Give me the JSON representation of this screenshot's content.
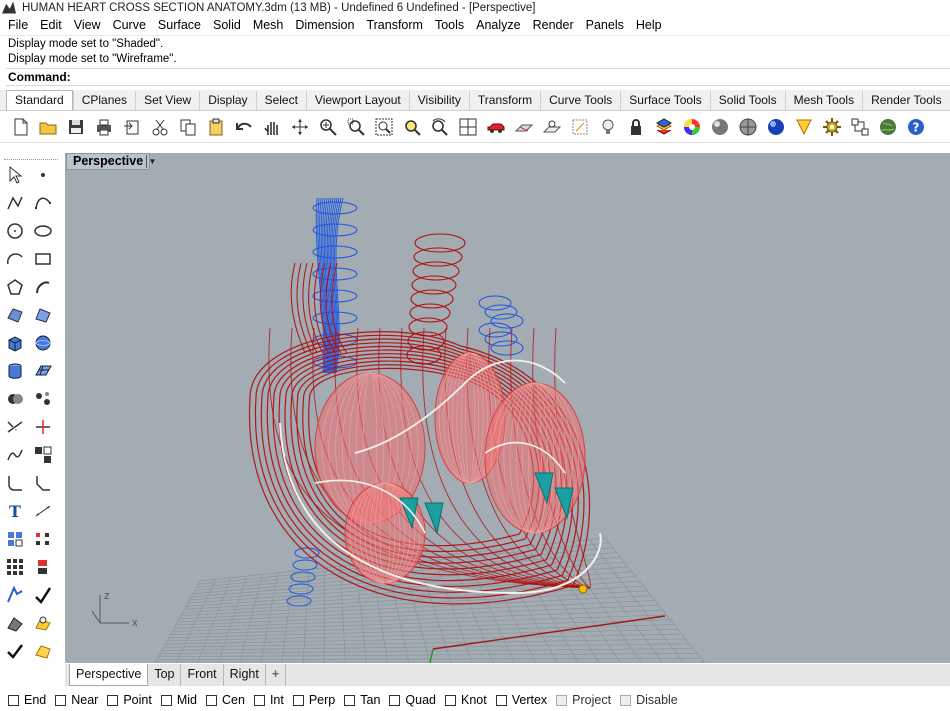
{
  "window": {
    "title": "HUMAN HEART CROSS SECTION ANATOMY.3dm (13 MB) - Undefined 6 Undefined - [Perspective]"
  },
  "menu": [
    "File",
    "Edit",
    "View",
    "Curve",
    "Surface",
    "Solid",
    "Mesh",
    "Dimension",
    "Transform",
    "Tools",
    "Analyze",
    "Render",
    "Panels",
    "Help"
  ],
  "history": [
    "Display mode set to \"Shaded\".",
    "Display mode set to \"Wireframe\"."
  ],
  "command": {
    "label": "Command:"
  },
  "toolbar_tabs": [
    "Standard",
    "CPlanes",
    "Set View",
    "Display",
    "Select",
    "Viewport Layout",
    "Visibility",
    "Transform",
    "Curve Tools",
    "Surface Tools",
    "Solid Tools",
    "Mesh Tools",
    "Render Tools"
  ],
  "toolbar_tabs_active": "Standard",
  "standard_icons": [
    "new-document-icon",
    "open-folder-icon",
    "save-icon",
    "print-icon",
    "import-icon",
    "cut-icon",
    "copy-icon",
    "paste-icon",
    "undo-icon",
    "pan-hand-icon",
    "rotate-view-icon",
    "zoom-icon",
    "zoom-window-icon",
    "zoom-extents-icon",
    "zoom-selected-icon",
    "rotate-camera-icon",
    "four-viewports-icon",
    "car-named-view-icon",
    "cplane-icon",
    "cplane-elevation-icon",
    "set-object-cplane-icon",
    "light-bulb-icon",
    "lock-icon",
    "layer-icon",
    "color-wheel-icon",
    "shaded-sphere-icon",
    "rendered-sphere-icon",
    "blue-sphere-icon",
    "grid-snap-icon",
    "gear-options-icon",
    "select-filter-icon",
    "globe-icon",
    "help-icon"
  ],
  "side_icons": [
    "select-arrow-icon",
    "point-icon",
    "polyline-icon",
    "curve-icon",
    "circle-icon",
    "ellipse-icon",
    "arc-icon",
    "rectangle-icon",
    "polygon-icon",
    "curve-edit-icon",
    "surface-corner-icon",
    "surface-patch-icon",
    "box-icon",
    "sphere-icon",
    "cylinder-icon",
    "mesh-plane-icon",
    "boolean-icon",
    "explode-icon",
    "trim-icon",
    "split-icon",
    "join-icon",
    "group-icon",
    "fillet-icon",
    "chamfer-icon",
    "text-icon",
    "dimension-icon",
    "block-icon",
    "point-cloud-icon",
    "array-icon",
    "move-icon",
    "scale-icon",
    "mirror-icon",
    "layer-panel-icon",
    "analyze-icon",
    "check-icon",
    "render-icon"
  ],
  "viewport": {
    "name": "Perspective",
    "axis_z": "z",
    "axis_x": "x",
    "background": "#a3abb3"
  },
  "view_tabs": [
    "Perspective",
    "Top",
    "Front",
    "Right"
  ],
  "view_tab_add": "+",
  "osnaps": [
    {
      "label": "End",
      "enabled": true
    },
    {
      "label": "Near",
      "enabled": true
    },
    {
      "label": "Point",
      "enabled": true
    },
    {
      "label": "Mid",
      "enabled": true
    },
    {
      "label": "Cen",
      "enabled": true
    },
    {
      "label": "Int",
      "enabled": true
    },
    {
      "label": "Perp",
      "enabled": true
    },
    {
      "label": "Tan",
      "enabled": true
    },
    {
      "label": "Quad",
      "enabled": true
    },
    {
      "label": "Knot",
      "enabled": true
    },
    {
      "label": "Vertex",
      "enabled": true
    },
    {
      "label": "Project",
      "enabled": false
    },
    {
      "label": "Disable",
      "enabled": false
    }
  ],
  "colors": {
    "wire_red": "#b01010",
    "wire_blue": "#1a55e0",
    "wire_cyan": "#1aa0a0",
    "wire_pink": "#f07070"
  }
}
